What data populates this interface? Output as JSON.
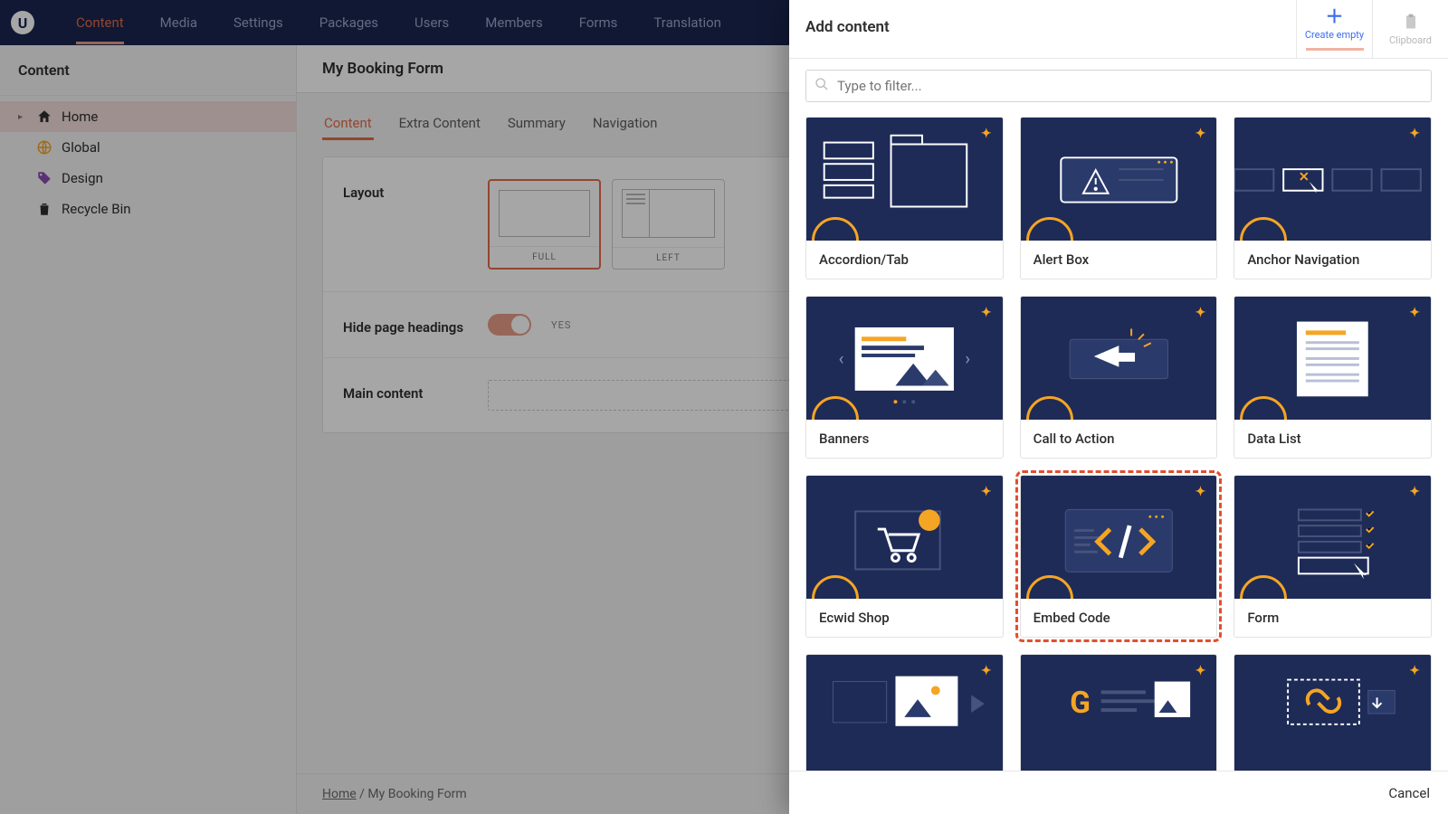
{
  "topnav": {
    "items": [
      {
        "label": "Content",
        "active": true
      },
      {
        "label": "Media"
      },
      {
        "label": "Settings"
      },
      {
        "label": "Packages"
      },
      {
        "label": "Users"
      },
      {
        "label": "Members"
      },
      {
        "label": "Forms"
      },
      {
        "label": "Translation"
      }
    ],
    "logo_letter": "U"
  },
  "sidebar": {
    "header": "Content",
    "items": [
      {
        "label": "Home",
        "icon": "home",
        "selected": true,
        "has_children": true
      },
      {
        "label": "Global",
        "icon": "globe"
      },
      {
        "label": "Design",
        "icon": "tag"
      },
      {
        "label": "Recycle Bin",
        "icon": "trash"
      }
    ]
  },
  "main": {
    "title": "My Booking Form",
    "tabs": [
      {
        "label": "Content",
        "active": true
      },
      {
        "label": "Extra Content"
      },
      {
        "label": "Summary"
      },
      {
        "label": "Navigation"
      }
    ],
    "panel": {
      "layout_label": "Layout",
      "layout_options": [
        {
          "label": "FULL",
          "selected": true
        },
        {
          "label": "LEFT",
          "selected": false
        }
      ],
      "hide_headings_label": "Hide page headings",
      "hide_headings_value": "YES",
      "main_content_label": "Main content"
    },
    "breadcrumb": [
      {
        "label": "Home",
        "link": true
      },
      {
        "label": "My Booking Form",
        "link": false
      }
    ]
  },
  "flyout": {
    "title": "Add content",
    "actions": {
      "create_empty": "Create empty",
      "clipboard": "Clipboard"
    },
    "search_placeholder": "Type to filter...",
    "cards": [
      {
        "label": "Accordion/Tab",
        "icon": "accordion"
      },
      {
        "label": "Alert Box",
        "icon": "alert"
      },
      {
        "label": "Anchor Navigation",
        "icon": "anchor"
      },
      {
        "label": "Banners",
        "icon": "banner"
      },
      {
        "label": "Call to Action",
        "icon": "cta"
      },
      {
        "label": "Data List",
        "icon": "datalist"
      },
      {
        "label": "Ecwid Shop",
        "icon": "cart"
      },
      {
        "label": "Embed Code",
        "icon": "code",
        "highlighted": true
      },
      {
        "label": "Form",
        "icon": "form"
      },
      {
        "label": "",
        "icon": "image"
      },
      {
        "label": "",
        "icon": "google"
      },
      {
        "label": "",
        "icon": "link"
      }
    ],
    "cancel_label": "Cancel"
  },
  "colors": {
    "accent": "#e46a4a",
    "highlight": "#f5a524",
    "navy": "#1e2b57"
  }
}
